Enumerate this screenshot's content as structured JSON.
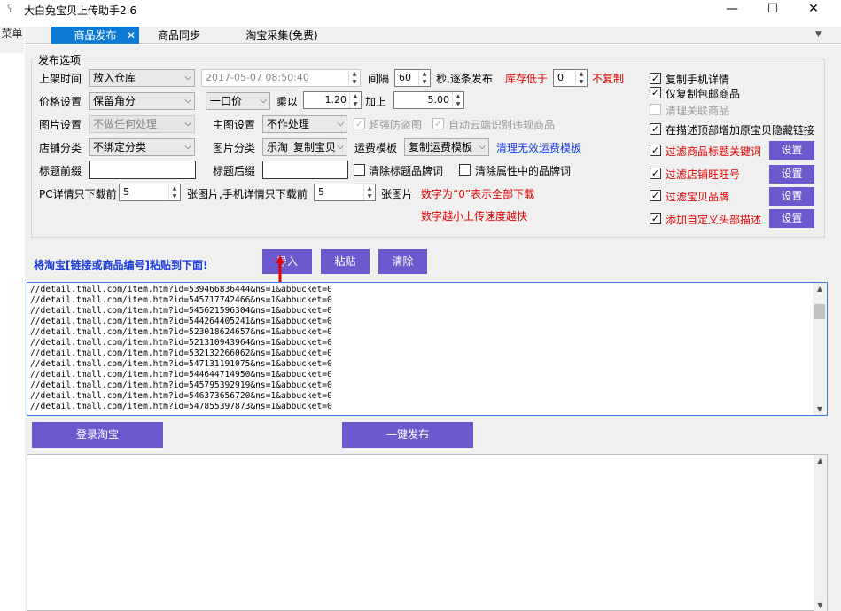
{
  "window": {
    "title": "大白兔宝贝上传助手2.6",
    "minimize": "—",
    "maximize": "☐",
    "close": "✕"
  },
  "side_menu": {
    "label": "菜单"
  },
  "tabs": [
    {
      "label": "商品发布",
      "active": true,
      "close": "✕"
    },
    {
      "label": "商品同步",
      "active": false
    },
    {
      "label": "淘宝采集(免费)",
      "active": false
    }
  ],
  "group": {
    "legend": "发布选项"
  },
  "form": {
    "listing_time_label": "上架时间",
    "listing_time_value": "放入仓库",
    "datetime_value": "2017-05-07 08:50:40",
    "interval_label": "间隔",
    "interval_value": "60",
    "interval_unit": "秒,逐条发布",
    "stock_below_label": "库存低于",
    "stock_below_value": "0",
    "no_copy_label": "不复制",
    "price_label": "价格设置",
    "price_value": "保留角分",
    "price_mode_value": "一口价",
    "multiply_label": "乘以",
    "multiply_value": "1.20",
    "add_label": "加上",
    "add_value": "5.00",
    "image_label": "图片设置",
    "image_value": "不做任何处理",
    "main_image_label": "主图设置",
    "main_image_value": "不作处理",
    "anti_theft_label": "超强防盗图",
    "cloud_detect_label": "自动云端识别违规商品",
    "shop_cat_label": "店铺分类",
    "shop_cat_value": "不绑定分类",
    "img_cat_label": "图片分类",
    "img_cat_value": "乐淘_复制宝贝",
    "freight_label": "运费模板",
    "freight_value": "复制运费模板",
    "clear_freight_link": "清理无效运费模板",
    "title_prefix_label": "标题前缀",
    "title_prefix_value": "",
    "title_suffix_label": "标题后缀",
    "title_suffix_value": "",
    "clear_title_brand_label": "清除标题品牌词",
    "clear_attr_brand_label": "清除属性中的品牌词",
    "pc_detail_label": "PC详情只下载前",
    "pc_detail_value": "5",
    "pc_detail_unit": "张图片,手机详情只下载前",
    "mobile_detail_value": "5",
    "mobile_detail_unit": "张图片",
    "note_zero": "数字为“0”表示全部下载",
    "note_speed": "数字越小上传速度越快"
  },
  "right_options": {
    "copy_mobile_detail": {
      "label": "复制手机详情",
      "checked": true
    },
    "only_free_shipping": {
      "label": "仅复制包邮商品",
      "checked": true
    },
    "clear_related": {
      "label": "清理关联商品",
      "checked": false,
      "disabled": true
    },
    "add_hidden_link": {
      "label": "在描述顶部增加原宝贝隐藏链接",
      "checked": true
    },
    "filter_title_keywords": {
      "label": "过滤商品标题关键词",
      "checked": true,
      "button": "设置"
    },
    "filter_shop_wangwang": {
      "label": "过滤店铺旺旺号",
      "checked": true,
      "button": "设置"
    },
    "filter_brand": {
      "label": "过滤宝贝品牌",
      "checked": true,
      "button": "设置"
    },
    "add_custom_header": {
      "label": "添加自定义头部描述",
      "checked": true,
      "button": "设置"
    }
  },
  "actions": {
    "hint": "将淘宝[链接或商品编号]粘贴到下面!",
    "import": "导入",
    "paste": "粘贴",
    "clear": "清除",
    "login": "登录淘宝",
    "publish": "一键发布"
  },
  "links": [
    "//detail.tmall.com/item.htm?id=539466836444&ns=1&abbucket=0",
    "//detail.tmall.com/item.htm?id=545717742466&ns=1&abbucket=0",
    "//detail.tmall.com/item.htm?id=545621596304&ns=1&abbucket=0",
    "//detail.tmall.com/item.htm?id=544264405241&ns=1&abbucket=0",
    "//detail.tmall.com/item.htm?id=523018624657&ns=1&abbucket=0",
    "//detail.tmall.com/item.htm?id=521310943964&ns=1&abbucket=0",
    "//detail.tmall.com/item.htm?id=532132266062&ns=1&abbucket=0",
    "//detail.tmall.com/item.htm?id=547131191075&ns=1&abbucket=0",
    "//detail.tmall.com/item.htm?id=544644714950&ns=1&abbucket=0",
    "//detail.tmall.com/item.htm?id=545795392919&ns=1&abbucket=0",
    "//detail.tmall.com/item.htm?id=546373656720&ns=1&abbucket=0",
    "//detail.tmall.com/item.htm?id=547855397873&ns=1&abbucket=0"
  ],
  "colors": {
    "accent": "#0e7ad8",
    "button": "#6a5acd",
    "warning": "#e00000",
    "hint": "#1a3de0"
  }
}
